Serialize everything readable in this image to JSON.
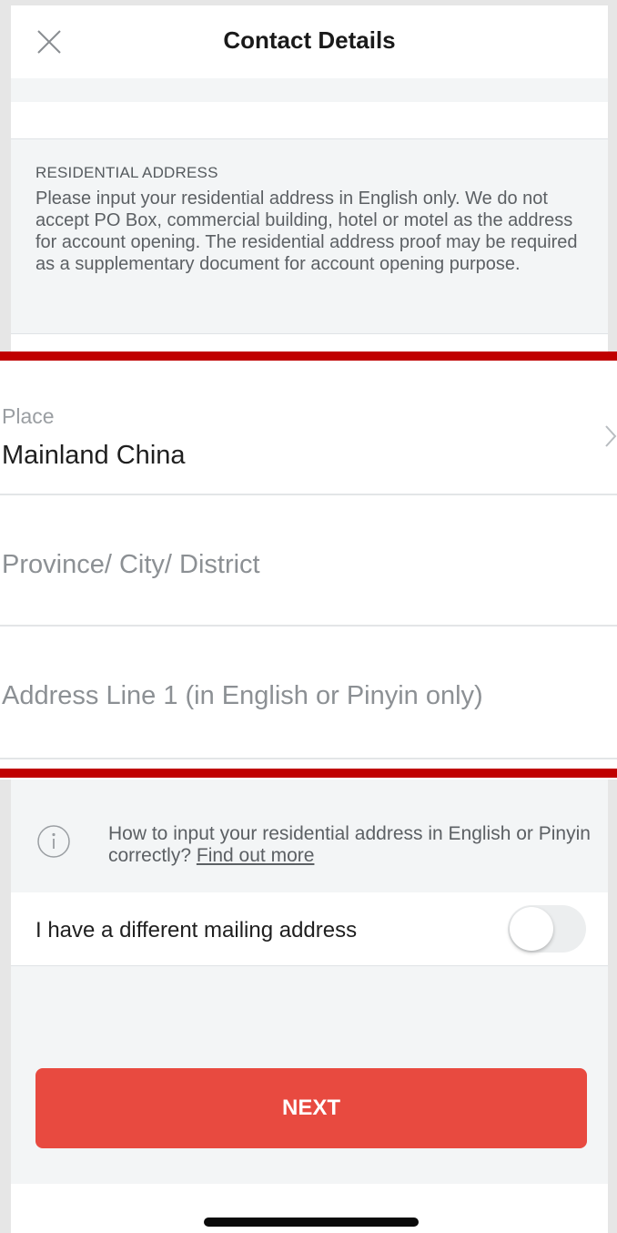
{
  "header": {
    "title": "Contact Details",
    "close_icon": "close-icon"
  },
  "notice": {
    "heading": "RESIDENTIAL ADDRESS",
    "body": "Please input your residential address in English only. We do not accept PO Box, commercial building, hotel or motel as the address for account opening. The residential address proof may be required as a supplementary document for account opening purpose."
  },
  "form": {
    "place": {
      "label": "Place",
      "value": "Mainland China",
      "icon": "chevron-right-icon"
    },
    "province": {
      "placeholder": "Province/ City/ District"
    },
    "address_line_1": {
      "placeholder": "Address Line 1 (in English or Pinyin only)"
    }
  },
  "info": {
    "icon": "info-icon",
    "text": "How to input your residential address in English or Pinyin correctly?",
    "link": "Find out more"
  },
  "mailing": {
    "label": "I have a different mailing address",
    "toggle_on": false
  },
  "actions": {
    "next_label": "NEXT"
  },
  "colors": {
    "accent": "#e84a40",
    "highlight_border": "#c00000",
    "background": "#f3f5f6"
  }
}
